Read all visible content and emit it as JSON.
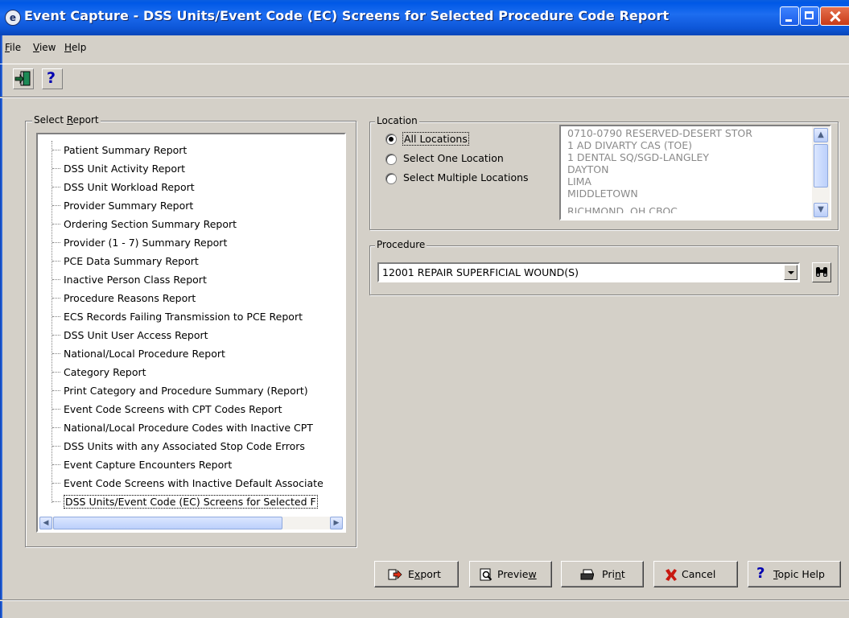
{
  "window": {
    "title": "Event Capture - DSS Units/Event Code (EC) Screens for Selected Procedure Code Report",
    "app_icon_glyph": "e",
    "controls": [
      "minimize",
      "maximize",
      "close"
    ]
  },
  "menu": {
    "items": [
      {
        "label": "File",
        "mnemonic": "F"
      },
      {
        "label": "View",
        "mnemonic": "V"
      },
      {
        "label": "Help",
        "mnemonic": "H"
      }
    ]
  },
  "toolbar": {
    "buttons": [
      {
        "name": "exit",
        "icon": "exit-door-icon"
      },
      {
        "name": "help",
        "icon": "help-question-icon",
        "glyph": "?"
      }
    ]
  },
  "select_report": {
    "legend": "Select Report",
    "items": [
      "Patient Summary Report",
      "DSS Unit Activity Report",
      "DSS Unit Workload Report",
      "Provider Summary Report",
      "Ordering Section Summary Report",
      "Provider (1 - 7) Summary Report",
      "PCE Data Summary Report",
      "Inactive Person Class Report",
      "Procedure Reasons Report",
      "ECS Records Failing Transmission to PCE Report",
      "DSS Unit User Access Report",
      "National/Local Procedure Report",
      "Category Report",
      "Print Category and Procedure Summary (Report)",
      "Event Code Screens with CPT Codes Report",
      "National/Local Procedure Codes with Inactive CPT",
      "DSS Units with any Associated Stop Code Errors",
      "Event Capture Encounters Report",
      "Event Code Screens with Inactive Default Associate",
      "DSS Units/Event Code (EC) Screens for Selected F"
    ],
    "selected_index": 19
  },
  "location": {
    "legend": "Location",
    "options": [
      {
        "label": "All Locations",
        "selected": true
      },
      {
        "label": "Select One Location",
        "selected": false
      },
      {
        "label": "Select Multiple Locations",
        "selected": false
      }
    ],
    "list": [
      "0710-0790 RESERVED-DESERT STOR",
      "1 AD DIVARTY CAS (TOE)",
      "1 DENTAL SQ/SGD-LANGLEY",
      "DAYTON",
      "LIMA",
      "MIDDLETOWN",
      "RICHMOND, OH CBOC"
    ]
  },
  "procedure": {
    "legend": "Procedure",
    "value": "12001  REPAIR SUPERFICIAL WOUND(S)",
    "find_icon": "binoculars-icon"
  },
  "actions": [
    {
      "label": "Export",
      "mnemonic": "x",
      "icon": "export-icon"
    },
    {
      "label": "Preview",
      "mnemonic": "w",
      "icon": "preview-icon"
    },
    {
      "label": "Print",
      "mnemonic": "n",
      "icon": "printer-icon"
    },
    {
      "label": "Cancel",
      "icon": "cancel-x-icon"
    },
    {
      "label": "Topic Help",
      "mnemonic": "T",
      "icon": "help-question-icon"
    }
  ]
}
